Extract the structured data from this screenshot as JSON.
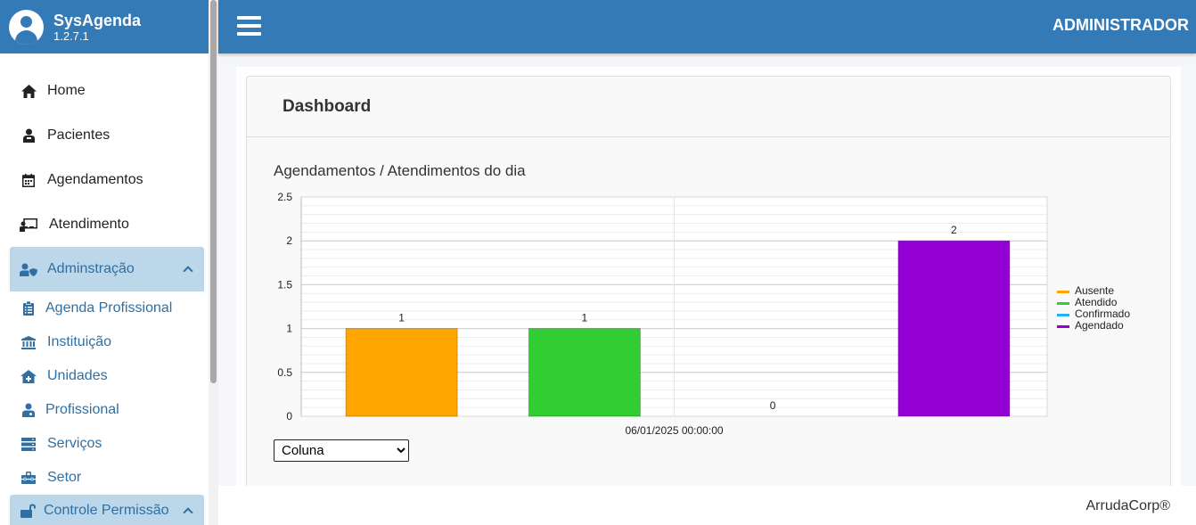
{
  "brand": {
    "name": "SysAgenda",
    "version": "1.2.7.1"
  },
  "topbar": {
    "user": "ADMINISTRADOR"
  },
  "menu": {
    "items": [
      {
        "label": "Home",
        "icon": "home-icon"
      },
      {
        "label": "Pacientes",
        "icon": "user-injured-icon"
      },
      {
        "label": "Agendamentos",
        "icon": "calendar-icon"
      },
      {
        "label": "Atendimento",
        "icon": "chalkboard-teacher-icon"
      },
      {
        "label": "Adminstração",
        "icon": "user-shield-icon"
      }
    ],
    "submenu": [
      {
        "label": "Agenda Profissional",
        "icon": "clipboard-list-icon"
      },
      {
        "label": "Instituição",
        "icon": "landmark-icon"
      },
      {
        "label": "Unidades",
        "icon": "house-medical-icon"
      },
      {
        "label": "Profissional",
        "icon": "user-doctor-icon"
      },
      {
        "label": "Serviços",
        "icon": "server-icon"
      },
      {
        "label": "Setor",
        "icon": "toolbox-icon"
      }
    ],
    "controle": {
      "label": "Controle Permissão",
      "icon": "unlock-icon"
    }
  },
  "card": {
    "title": "Dashboard",
    "chart_title": "Agendamentos / Atendimentos do dia"
  },
  "select": {
    "value": "Coluna",
    "options": [
      "Coluna"
    ]
  },
  "footer": {
    "text": "ArrudaCorp®"
  },
  "chart_data": {
    "type": "bar",
    "categories": [
      "06/01/2025 00:00:00"
    ],
    "series": [
      {
        "name": "Ausente",
        "values": [
          1
        ],
        "color": "#FFA500"
      },
      {
        "name": "Atendido",
        "values": [
          1
        ],
        "color": "#32CD32"
      },
      {
        "name": "Confirmado",
        "values": [
          0
        ],
        "color": "#1EB4F0"
      },
      {
        "name": "Agendado",
        "values": [
          2
        ],
        "color": "#9400D3"
      }
    ],
    "ylim": [
      0,
      2.5
    ],
    "yticks": [
      "0",
      "0.5",
      "1",
      "1.5",
      "2",
      "2.5"
    ],
    "grid": true,
    "legend": "right"
  }
}
